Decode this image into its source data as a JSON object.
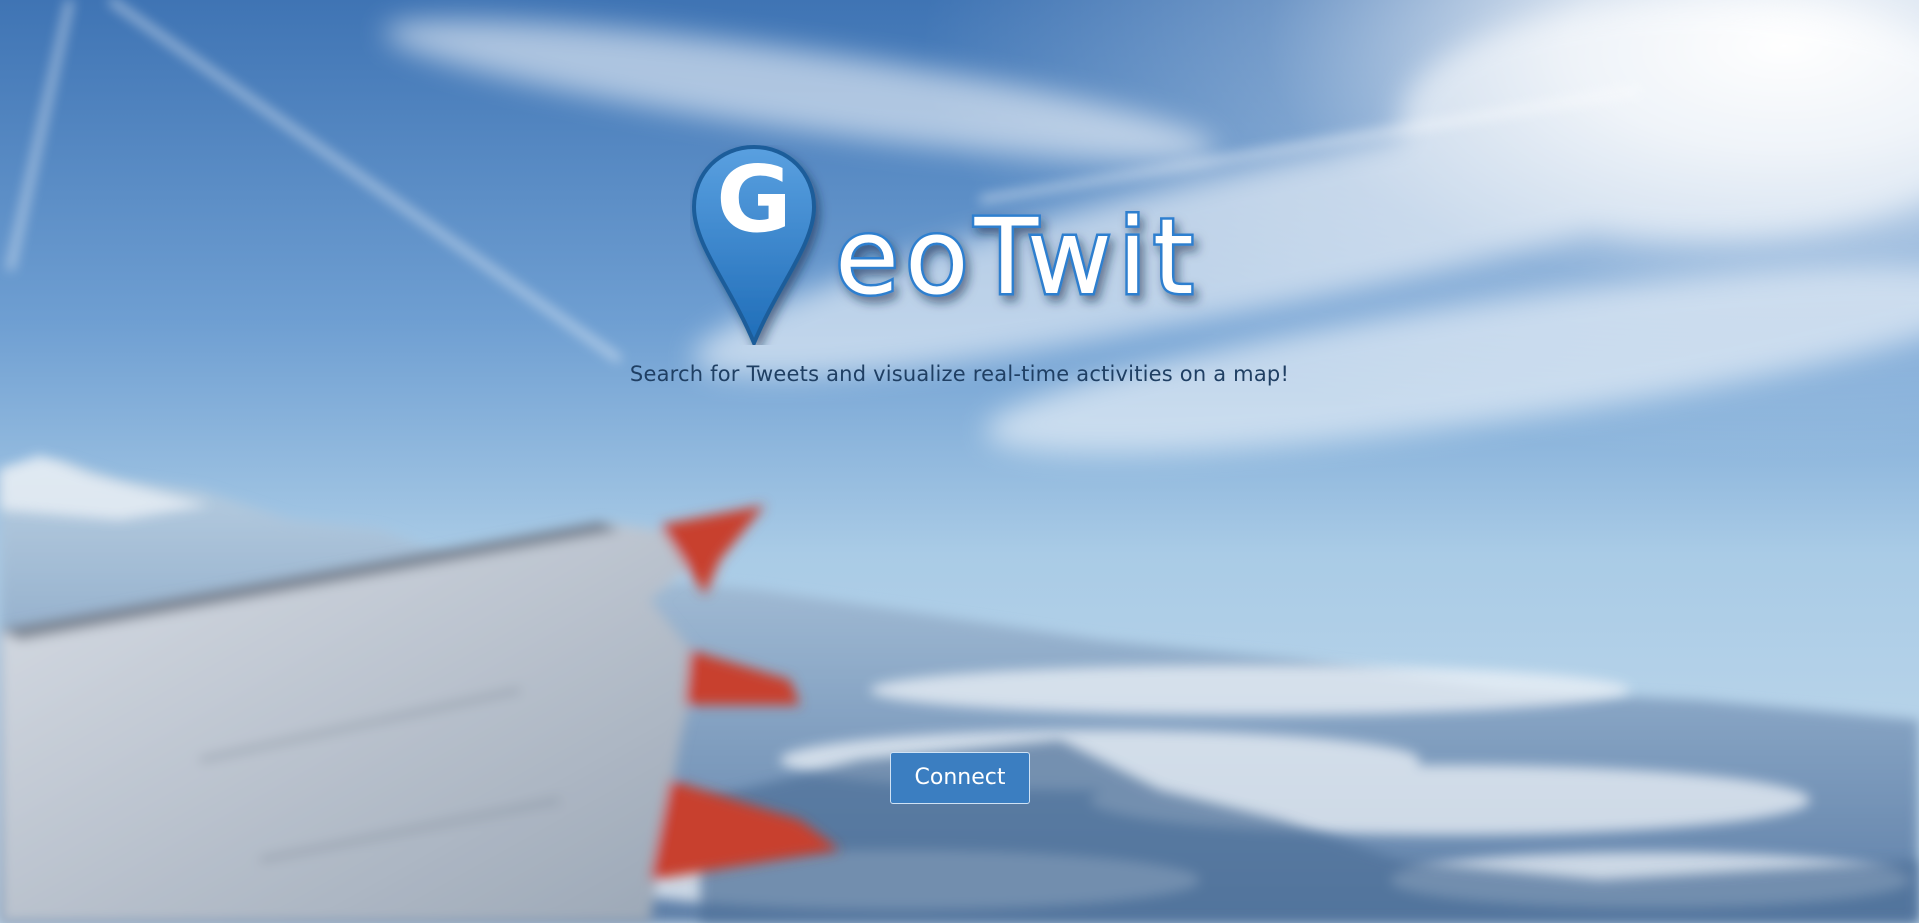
{
  "hero": {
    "logo_initial": "G",
    "logo_text": "eoTwit",
    "tagline": "Search for Tweets and visualize real-time activities on a map!"
  },
  "actions": {
    "connect_label": "Connect"
  },
  "colors": {
    "brand_blue": "#2f7fcf",
    "button_blue": "#3b7ec1",
    "tagline": "#1f3f63",
    "wing_tip": "#c8402d"
  }
}
